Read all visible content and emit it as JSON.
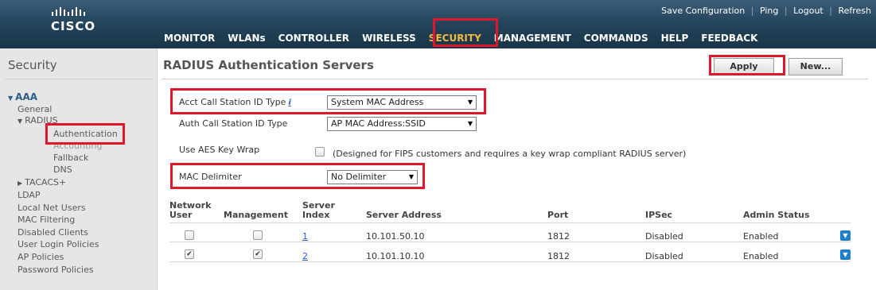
{
  "header": {
    "logo_text": "CISCO",
    "utility_links": [
      {
        "label": "Save Configuration"
      },
      {
        "label": "Ping"
      },
      {
        "label": "Logout"
      },
      {
        "label": "Refresh"
      }
    ],
    "nav": [
      {
        "label": "MONITOR"
      },
      {
        "label": "WLANs"
      },
      {
        "label": "CONTROLLER"
      },
      {
        "label": "WIRELESS"
      },
      {
        "label": "SECURITY",
        "active": true
      },
      {
        "label": "MANAGEMENT"
      },
      {
        "label": "COMMANDS"
      },
      {
        "label": "HELP"
      },
      {
        "label": "FEEDBACK"
      }
    ]
  },
  "sidebar": {
    "title": "Security",
    "items": {
      "aaa": "AAA",
      "general": "General",
      "radius": "RADIUS",
      "authentication": "Authentication",
      "accounting": "Accounting",
      "fallback": "Fallback",
      "dns": "DNS",
      "tacacs": "TACACS+",
      "ldap": "LDAP",
      "local_net_users": "Local Net Users",
      "mac_filtering": "MAC Filtering",
      "disabled_clients": "Disabled Clients",
      "user_login_policies": "User Login Policies",
      "ap_policies": "AP Policies",
      "password_policies": "Password Policies"
    }
  },
  "main": {
    "title": "RADIUS Authentication Servers",
    "apply_label": "Apply",
    "new_label": "New...",
    "form": {
      "acct_label": "Acct Call Station ID Type",
      "acct_info": "i",
      "acct_value": "System MAC Address",
      "auth_label": "Auth Call Station ID Type",
      "auth_value": "AP MAC Address:SSID",
      "aes_label": "Use AES Key Wrap",
      "aes_checked": false,
      "aes_note": "(Designed for FIPS customers and requires a key wrap compliant RADIUS server)",
      "mac_label": "MAC Delimiter",
      "mac_value": "No Delimiter"
    },
    "table": {
      "headers": {
        "network_user_1": "Network",
        "network_user_2": "User",
        "management": "Management",
        "server_index_1": "Server",
        "server_index_2": "Index",
        "server_address": "Server Address",
        "port": "Port",
        "ipsec": "IPSec",
        "admin_status": "Admin Status"
      },
      "rows": [
        {
          "network_user": false,
          "management": false,
          "index": "1",
          "address": "10.101.50.10",
          "port": "1812",
          "ipsec": "Disabled",
          "status": "Enabled"
        },
        {
          "network_user": true,
          "management": true,
          "index": "2",
          "address": "10.101.10.10",
          "port": "1812",
          "ipsec": "Disabled",
          "status": "Enabled"
        }
      ]
    }
  },
  "colors": {
    "highlight": "#e0162b",
    "active_nav": "#f4b942",
    "header_bg": "#24455c",
    "link": "#2a5dcf"
  },
  "icons": {
    "row_action": "chevron-down-icon",
    "dropdown": "triangle-down-icon"
  }
}
